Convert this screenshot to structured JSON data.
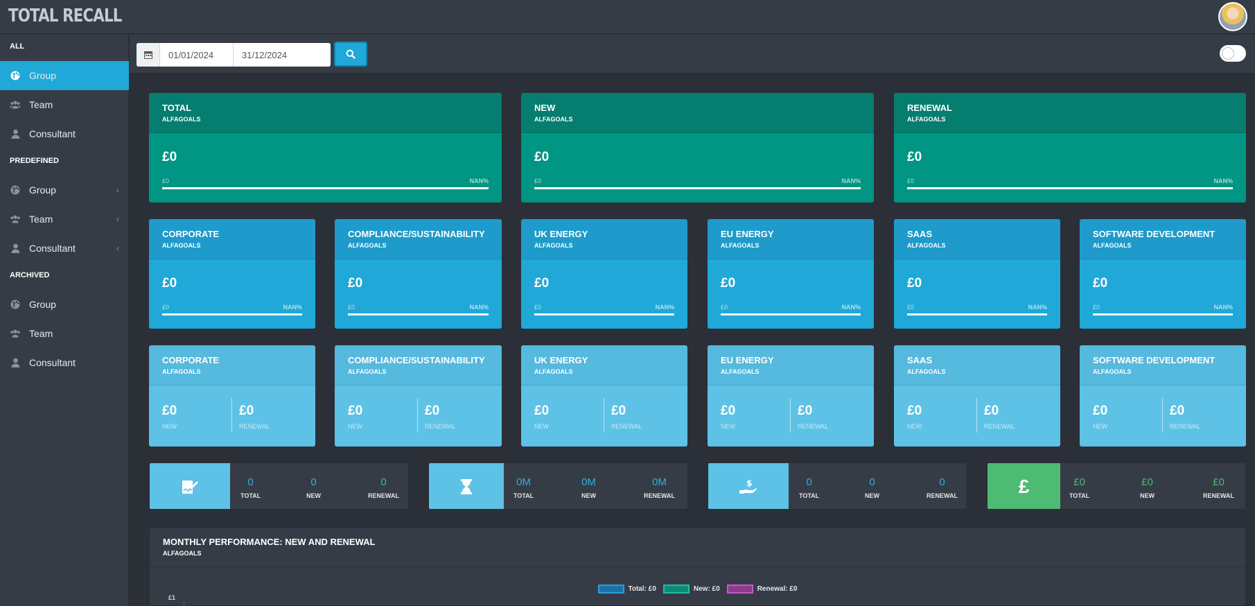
{
  "app": {
    "title": "TOTAL RECALL"
  },
  "colors": {
    "accent": "#1fa8d8",
    "goal_green": "#009683",
    "money_green": "#4dbb73"
  },
  "sidebar": {
    "sections": [
      {
        "heading": "ALL",
        "items": [
          {
            "label": "Group",
            "icon": "globe-icon",
            "active": true
          },
          {
            "label": "Team",
            "icon": "users-icon"
          },
          {
            "label": "Consultant",
            "icon": "user-icon"
          }
        ]
      },
      {
        "heading": "PREDEFINED",
        "items": [
          {
            "label": "Group",
            "icon": "globe-icon",
            "chevron": "‹"
          },
          {
            "label": "Team",
            "icon": "users-icon",
            "chevron": "‹"
          },
          {
            "label": "Consultant",
            "icon": "user-icon",
            "chevron": "‹"
          }
        ]
      },
      {
        "heading": "ARCHIVED",
        "items": [
          {
            "label": "Group",
            "icon": "globe-icon"
          },
          {
            "label": "Team",
            "icon": "users-icon"
          },
          {
            "label": "Consultant",
            "icon": "user-icon"
          }
        ]
      }
    ]
  },
  "toolbar": {
    "date_from": "01/01/2024",
    "date_to": "31/12/2024"
  },
  "summary_cards": [
    {
      "title": "TOTAL",
      "sub": "ALFAGOALS",
      "value": "£0",
      "min": "£0",
      "pct": "NAN%"
    },
    {
      "title": "NEW",
      "sub": "ALFAGOALS",
      "value": "£0",
      "min": "£0",
      "pct": "NAN%"
    },
    {
      "title": "RENEWAL",
      "sub": "ALFAGOALS",
      "value": "£0",
      "min": "£0",
      "pct": "NAN%"
    }
  ],
  "sector_cards": [
    {
      "title": "CORPORATE",
      "sub": "ALFAGOALS",
      "value": "£0",
      "min": "£0",
      "pct": "NAN%"
    },
    {
      "title": "COMPLIANCE/SUSTAINABILITY",
      "sub": "ALFAGOALS",
      "value": "£0",
      "min": "£0",
      "pct": "NAN%"
    },
    {
      "title": "UK ENERGY",
      "sub": "ALFAGOALS",
      "value": "£0",
      "min": "£0",
      "pct": "NAN%"
    },
    {
      "title": "EU ENERGY",
      "sub": "ALFAGOALS",
      "value": "£0",
      "min": "£0",
      "pct": "NAN%"
    },
    {
      "title": "SAAS",
      "sub": "ALFAGOALS",
      "value": "£0",
      "min": "£0",
      "pct": "NAN%"
    },
    {
      "title": "SOFTWARE DEVELOPMENT",
      "sub": "ALFAGOALS",
      "value": "£0",
      "min": "£0",
      "pct": "NAN%"
    }
  ],
  "split_cards": [
    {
      "title": "CORPORATE",
      "sub": "ALFAGOALS",
      "new_value": "£0",
      "new_label": "NEW",
      "renewal_value": "£0",
      "renewal_label": "RENEWAL"
    },
    {
      "title": "COMPLIANCE/SUSTAINABILITY",
      "sub": "ALFAGOALS",
      "new_value": "£0",
      "new_label": "NEW",
      "renewal_value": "£0",
      "renewal_label": "RENEWAL"
    },
    {
      "title": "UK ENERGY",
      "sub": "ALFAGOALS",
      "new_value": "£0",
      "new_label": "NEW",
      "renewal_value": "£0",
      "renewal_label": "RENEWAL"
    },
    {
      "title": "EU ENERGY",
      "sub": "ALFAGOALS",
      "new_value": "£0",
      "new_label": "NEW",
      "renewal_value": "£0",
      "renewal_label": "RENEWAL"
    },
    {
      "title": "SAAS",
      "sub": "ALFAGOALS",
      "new_value": "£0",
      "new_label": "NEW",
      "renewal_value": "£0",
      "renewal_label": "RENEWAL"
    },
    {
      "title": "SOFTWARE DEVELOPMENT",
      "sub": "ALFAGOALS",
      "new_value": "£0",
      "new_label": "NEW",
      "renewal_value": "£0",
      "renewal_label": "RENEWAL"
    }
  ],
  "stats": [
    {
      "icon": "signed-document-icon",
      "icon_bg": "#5ec2e6",
      "values": [
        {
          "value": "0",
          "label": "TOTAL"
        },
        {
          "value": "0",
          "label": "NEW"
        },
        {
          "value": "0",
          "label": "RENEWAL"
        }
      ]
    },
    {
      "icon": "hourglass-icon",
      "icon_bg": "#5ec2e6",
      "values": [
        {
          "value": "0M",
          "label": "TOTAL"
        },
        {
          "value": "0M",
          "label": "NEW"
        },
        {
          "value": "0M",
          "label": "RENEWAL"
        }
      ]
    },
    {
      "icon": "hand-money-icon",
      "icon_bg": "#5ec2e6",
      "values": [
        {
          "value": "0",
          "label": "TOTAL"
        },
        {
          "value": "0",
          "label": "NEW"
        },
        {
          "value": "0",
          "label": "RENEWAL"
        }
      ]
    },
    {
      "icon": "pound-icon",
      "icon_text": "£",
      "icon_bg": "#4dbb73",
      "values": [
        {
          "value": "£0",
          "label": "TOTAL"
        },
        {
          "value": "£0",
          "label": "NEW"
        },
        {
          "value": "£0",
          "label": "RENEWAL"
        }
      ]
    }
  ],
  "chart_panel": {
    "title": "MONTHLY PERFORMANCE: NEW AND RENEWAL",
    "sub": "ALFAGOALS",
    "legend": [
      {
        "label": "Total: £0",
        "fill": "#1d6fa5",
        "border": "#2a9ee0"
      },
      {
        "label": "New: £0",
        "fill": "#0e8a79",
        "border": "#1dbfa5"
      },
      {
        "label": "Renewal: £0",
        "fill": "#8e3b8e",
        "border": "#c45cc4"
      }
    ],
    "ytick_top": "£1"
  },
  "chart_data": {
    "type": "bar",
    "title": "MONTHLY PERFORMANCE: NEW AND RENEWAL",
    "series": [
      {
        "name": "Total: £0",
        "values": []
      },
      {
        "name": "New: £0",
        "values": []
      },
      {
        "name": "Renewal: £0",
        "values": []
      }
    ],
    "yticks": [
      "£1"
    ],
    "legend_position": "top-center"
  }
}
